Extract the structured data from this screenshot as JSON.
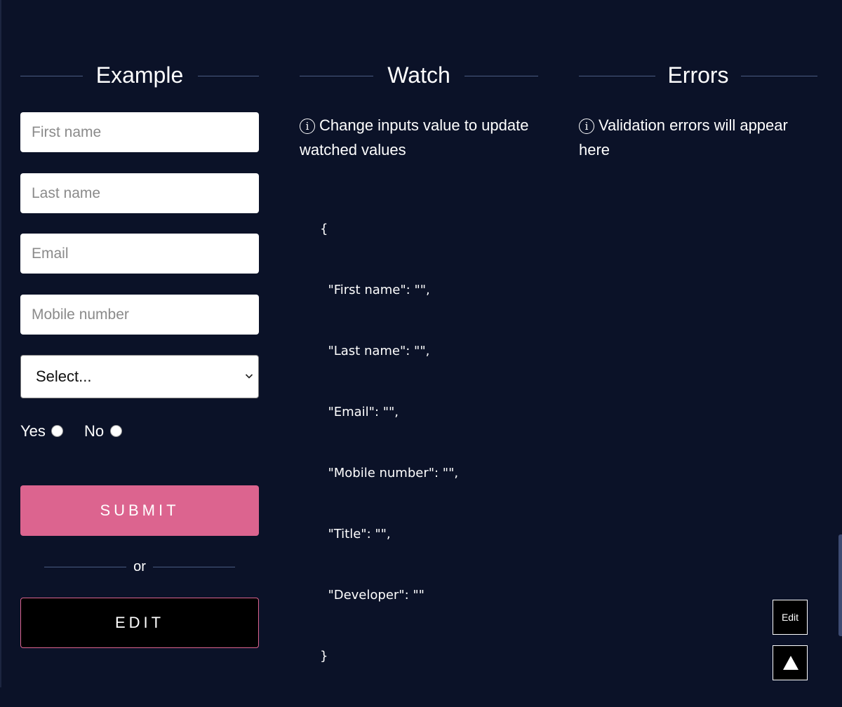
{
  "example": {
    "heading": "Example",
    "fields": [
      {
        "placeholder": "First name",
        "value": ""
      },
      {
        "placeholder": "Last name",
        "value": ""
      },
      {
        "placeholder": "Email",
        "value": ""
      },
      {
        "placeholder": "Mobile number",
        "value": ""
      }
    ],
    "select": {
      "selected": "Select..."
    },
    "radios": [
      {
        "label": "Yes",
        "checked": false
      },
      {
        "label": "No",
        "checked": false
      }
    ],
    "submit_label": "SUBMIT",
    "or_label": "or",
    "edit_label": "EDIT"
  },
  "watch": {
    "heading": "Watch",
    "info_icon": "ⓘ",
    "info_text": "Change inputs value to update watched values",
    "json_lines": [
      "{",
      "  \"First name\": \"\",",
      "  \"Last name\": \"\",",
      "  \"Email\": \"\",",
      "  \"Mobile number\": \"\",",
      "  \"Title\": \"\",",
      "  \"Developer\": \"\"",
      "}"
    ]
  },
  "errors": {
    "heading": "Errors",
    "info_icon": "ⓘ",
    "info_text": "Validation errors will appear here"
  },
  "floating": {
    "edit_label": "Edit",
    "scroll_top_icon": "triangle-up-icon"
  },
  "colors": {
    "background": "#0b1228",
    "accent_pink": "#dc648f",
    "divider": "#4a5b82"
  }
}
